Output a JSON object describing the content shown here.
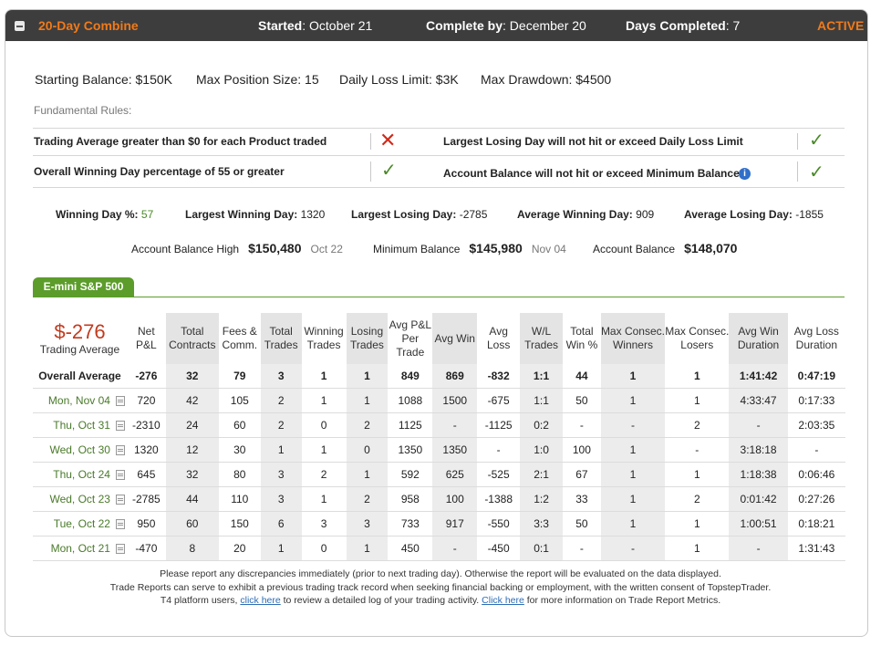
{
  "header": {
    "title": "20-Day Combine",
    "started_label": "Started",
    "started_value": ": October 21",
    "complete_label": "Complete by",
    "complete_value": ": December 20",
    "days_label": "Days Completed",
    "days_value": ": 7",
    "status": "ACTIVE",
    "accent": "#f07a1a"
  },
  "params": {
    "starting_balance": "Starting Balance: $150K",
    "max_position": "Max Position Size: 15",
    "daily_loss": "Daily Loss Limit: $3K",
    "max_drawdown": "Max Drawdown: $4500"
  },
  "rules": {
    "heading": "Fundamental Rules:",
    "items": [
      {
        "text": "Trading Average greater than $0 for each Product traded",
        "status": "fail",
        "mark": "✕"
      },
      {
        "text": "Largest Losing Day will not hit or exceed Daily Loss Limit",
        "status": "pass",
        "mark": "✓"
      },
      {
        "text": "Overall Winning Day percentage of 55 or greater",
        "status": "pass",
        "mark": "✓"
      },
      {
        "text": "Account Balance will not hit or exceed Minimum Balance",
        "status": "pass",
        "mark": "✓"
      }
    ]
  },
  "stats": {
    "winning_pct_label": "Winning Day %:",
    "winning_pct_value": "57",
    "largest_win_label": "Largest Winning Day:",
    "largest_win_value": "1320",
    "largest_loss_label": "Largest Losing Day:",
    "largest_loss_value": "-2785",
    "avg_win_label": "Average Winning Day:",
    "avg_win_value": "909",
    "avg_loss_label": "Average Losing Day:",
    "avg_loss_value": "-1855"
  },
  "balances": {
    "high_label": "Account Balance High",
    "high_value": "$150,480",
    "high_date": "Oct 22",
    "min_label": "Minimum Balance",
    "min_value": "$145,980",
    "min_date": "Nov 04",
    "bal_label": "Account Balance",
    "bal_value": "$148,070"
  },
  "product_tab": "E-mini S&P 500",
  "summary": {
    "pnl": "$-276",
    "pnl_label": "Trading Average"
  },
  "columns": [
    "Net P&L",
    "Total Contracts",
    "Fees & Comm.",
    "Total Trades",
    "Winning Trades",
    "Losing Trades",
    "Avg P&L Per Trade",
    "Avg Win",
    "Avg Loss",
    "W/L Trades",
    "Total Win %",
    "Max Consec. Winners",
    "Max Consec. Losers",
    "Avg Win Duration",
    "Avg Loss Duration"
  ],
  "average_row": {
    "label": "Overall Average",
    "cells": [
      "-276",
      "32",
      "79",
      "3",
      "1",
      "1",
      "849",
      "869",
      "-832",
      "1:1",
      "44",
      "1",
      "1",
      "1:41:42",
      "0:47:19"
    ]
  },
  "rows": [
    {
      "date": "Mon, Nov 04",
      "cells": [
        "720",
        "42",
        "105",
        "2",
        "1",
        "1",
        "1088",
        "1500",
        "-675",
        "1:1",
        "50",
        "1",
        "1",
        "4:33:47",
        "0:17:33"
      ]
    },
    {
      "date": "Thu, Oct 31",
      "cells": [
        "-2310",
        "24",
        "60",
        "2",
        "0",
        "2",
        "1125",
        "-",
        "-1125",
        "0:2",
        "-",
        "-",
        "2",
        "-",
        "2:03:35"
      ]
    },
    {
      "date": "Wed, Oct 30",
      "cells": [
        "1320",
        "12",
        "30",
        "1",
        "1",
        "0",
        "1350",
        "1350",
        "-",
        "1:0",
        "100",
        "1",
        "-",
        "3:18:18",
        "-"
      ]
    },
    {
      "date": "Thu, Oct 24",
      "cells": [
        "645",
        "32",
        "80",
        "3",
        "2",
        "1",
        "592",
        "625",
        "-525",
        "2:1",
        "67",
        "1",
        "1",
        "1:18:38",
        "0:06:46"
      ]
    },
    {
      "date": "Wed, Oct 23",
      "cells": [
        "-2785",
        "44",
        "110",
        "3",
        "1",
        "2",
        "958",
        "100",
        "-1388",
        "1:2",
        "33",
        "1",
        "2",
        "0:01:42",
        "0:27:26"
      ]
    },
    {
      "date": "Tue, Oct 22",
      "cells": [
        "950",
        "60",
        "150",
        "6",
        "3",
        "3",
        "733",
        "917",
        "-550",
        "3:3",
        "50",
        "1",
        "1",
        "1:00:51",
        "0:18:21"
      ]
    },
    {
      "date": "Mon, Oct 21",
      "cells": [
        "-470",
        "8",
        "20",
        "1",
        "0",
        "1",
        "450",
        "-",
        "-450",
        "0:1",
        "-",
        "-",
        "1",
        "-",
        "1:31:43"
      ]
    }
  ],
  "footer": {
    "line1": "Please report any discrepancies immediately (prior to next trading day). Otherwise the report will be evaluated on the data displayed.",
    "line2": "Trade Reports can serve to exhibit a previous trading track record when seeking financial backing or employment, with the written consent of TopstepTrader.",
    "line3_a": "T4 platform users,",
    "link1": "click here",
    "line3_b": "to review a detailed log of your trading activity.",
    "link2": "Click here",
    "line3_c": "for more information on Trade Report Metrics."
  }
}
